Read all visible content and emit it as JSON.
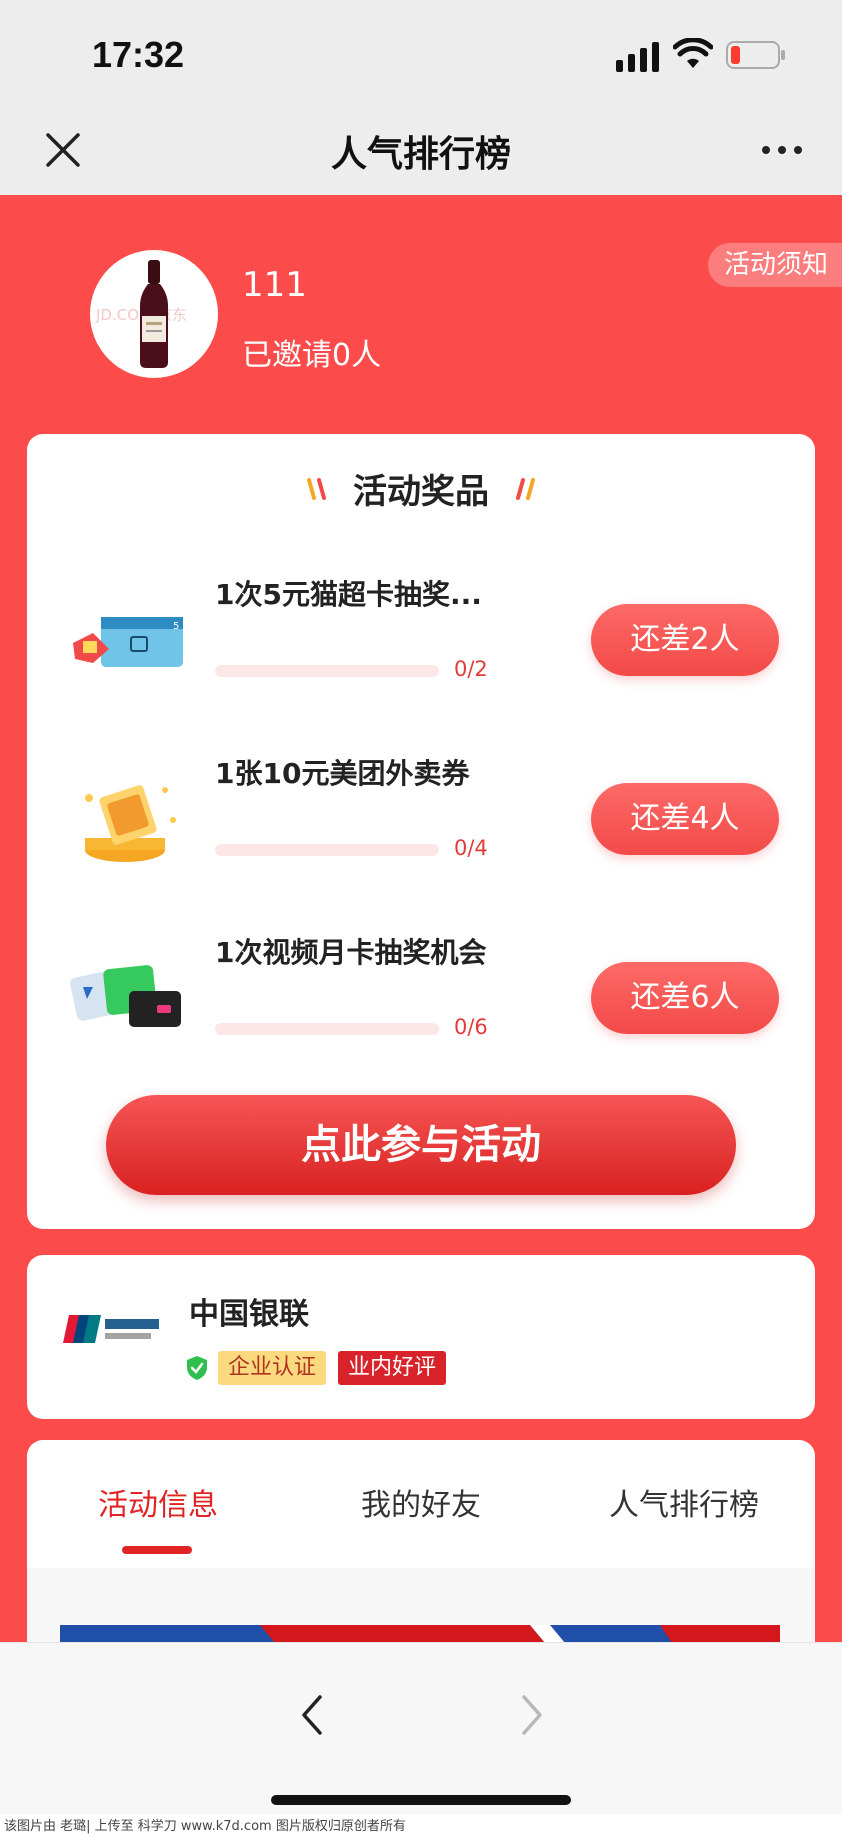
{
  "status_bar": {
    "time": "17:32"
  },
  "nav": {
    "title": "人气排行榜"
  },
  "profile": {
    "name": "111",
    "invited": "已邀请0人",
    "notice_label": "活动须知",
    "avatar_watermark": "JD.COM 京东"
  },
  "prize_section": {
    "title": "活动奖品",
    "prizes": [
      {
        "name": "1次5元猫超卡抽奖...",
        "progress": "0/2",
        "progress_fraction": 0,
        "button": "还差2人"
      },
      {
        "name": "1张10元美团外卖券",
        "progress": "0/4",
        "progress_fraction": 0,
        "button": "还差4人"
      },
      {
        "name": "1次视频月卡抽奖机会",
        "progress": "0/6",
        "progress_fraction": 0,
        "button": "还差6人"
      }
    ],
    "join_button": "点此参与活动"
  },
  "merchant": {
    "name": "中国银联",
    "tags": [
      "企业认证",
      "业内好评"
    ]
  },
  "tabs": [
    {
      "label": "活动信息",
      "active": true
    },
    {
      "label": "我的好友",
      "active": false
    },
    {
      "label": "人气排行榜",
      "active": false
    }
  ],
  "colors": {
    "background_red": "#fb4c4b",
    "accent_red": "#e02425",
    "button_red": "#f24a48"
  },
  "footer_note": "该图片由 老璐| 上传至 科学刀 www.k7d.com 图片版权归原创者所有"
}
